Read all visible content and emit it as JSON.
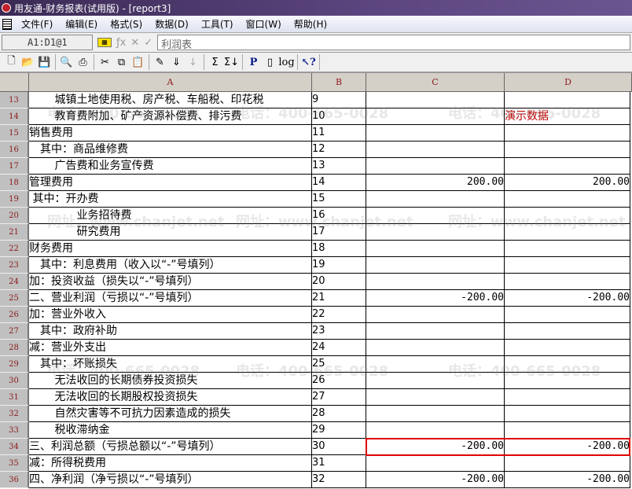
{
  "window": {
    "title": "用友通-财务报表(试用版) - [report3]"
  },
  "menu": [
    "文件(F)",
    "编辑(E)",
    "格式(S)",
    "数据(D)",
    "工具(T)",
    "窗口(W)",
    "帮助(H)"
  ],
  "formula_bar": {
    "cell_ref": "A1:D1@1",
    "value": "利润表"
  },
  "watermark": {
    "phone": "电话：400-665-0028",
    "site": "网址：www.chanjet.net"
  },
  "columns": [
    "A",
    "B",
    "C",
    "D"
  ],
  "rows": [
    {
      "n": "13",
      "a": "　　 城镇土地使用税、房产税、车船税、印花税",
      "b": "9",
      "c": "",
      "d": ""
    },
    {
      "n": "14",
      "a": "　　 教育费附加、矿产资源补偿费、排污费",
      "b": "10",
      "c": "",
      "d": "演示数据"
    },
    {
      "n": "15",
      "a": "销售费用",
      "b": "11",
      "c": "",
      "d": ""
    },
    {
      "n": "16",
      "a": "　其中：商品维修费",
      "b": "12",
      "c": "",
      "d": ""
    },
    {
      "n": "17",
      "a": "　　 广告费和业务宣传费",
      "b": "13",
      "c": "",
      "d": ""
    },
    {
      "n": "18",
      "a": "管理费用",
      "b": "14",
      "c": "200.00",
      "d": "200.00"
    },
    {
      "n": "19",
      "a": " 其中：开办费",
      "b": "15",
      "c": "",
      "d": ""
    },
    {
      "n": "20",
      "a": "　　　　 业务招待费",
      "b": "16",
      "c": "",
      "d": ""
    },
    {
      "n": "21",
      "a": "　　　　 研究费用",
      "b": "17",
      "c": "",
      "d": ""
    },
    {
      "n": "22",
      "a": "财务费用",
      "b": "18",
      "c": "",
      "d": ""
    },
    {
      "n": "23",
      "a": "　其中：利息费用（收入以“-”号填列）",
      "b": "19",
      "c": "",
      "d": ""
    },
    {
      "n": "24",
      "a": "加：投资收益（损失以“-”号填列）",
      "b": "20",
      "c": "",
      "d": ""
    },
    {
      "n": "25",
      "a": "二、营业利润（亏损以“-”号填列）",
      "b": "21",
      "c": "-200.00",
      "d": "-200.00"
    },
    {
      "n": "26",
      "a": "加：营业外收入",
      "b": "22",
      "c": "",
      "d": ""
    },
    {
      "n": "27",
      "a": "　其中：政府补助",
      "b": "23",
      "c": "",
      "d": ""
    },
    {
      "n": "28",
      "a": "减：营业外支出",
      "b": "24",
      "c": "",
      "d": ""
    },
    {
      "n": "29",
      "a": "　其中：坏账损失",
      "b": "25",
      "c": "",
      "d": ""
    },
    {
      "n": "30",
      "a": "　　 无法收回的长期债券投资损失",
      "b": "26",
      "c": "",
      "d": ""
    },
    {
      "n": "31",
      "a": "　　 无法收回的长期股权投资损失",
      "b": "27",
      "c": "",
      "d": ""
    },
    {
      "n": "32",
      "a": "　　 自然灾害等不可抗力因素造成的损失",
      "b": "28",
      "c": "",
      "d": ""
    },
    {
      "n": "33",
      "a": "　　 税收滞纳金",
      "b": "29",
      "c": "",
      "d": ""
    },
    {
      "n": "34",
      "a": "三、利润总额（亏损总额以“-”号填列）",
      "b": "30",
      "c": "-200.00",
      "d": "-200.00"
    },
    {
      "n": "35",
      "a": "减：所得税费用",
      "b": "31",
      "c": "",
      "d": ""
    },
    {
      "n": "36",
      "a": "四、净利润（净亏损以“-”号填列）",
      "b": "32",
      "c": "-200.00",
      "d": "-200.00"
    }
  ]
}
